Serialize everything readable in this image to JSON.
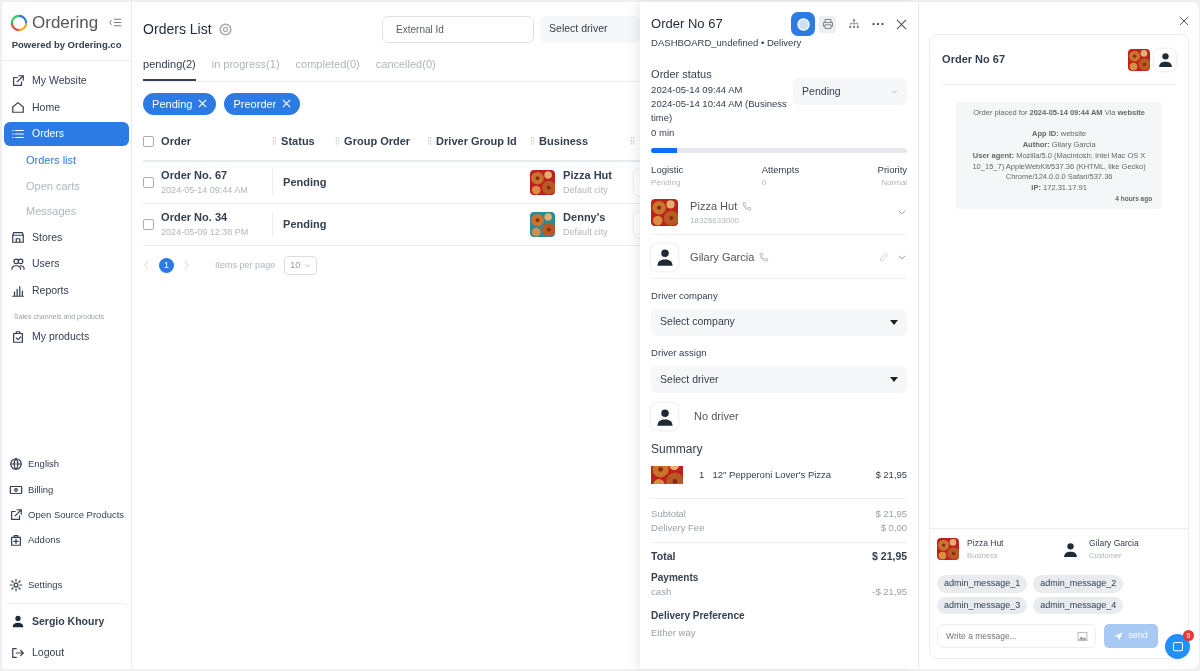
{
  "sidebar": {
    "logo": "Ordering",
    "powered_by": "Powered by Ordering.co",
    "items": [
      {
        "kind": "item",
        "label": "My Website",
        "selected": false
      },
      {
        "kind": "item",
        "label": "Home",
        "selected": false
      },
      {
        "kind": "item",
        "label": "Orders",
        "selected": true
      },
      {
        "kind": "sub",
        "label": "Orders list",
        "selected": true
      },
      {
        "kind": "sub",
        "label": "Open carts",
        "selected": false
      },
      {
        "kind": "sub",
        "label": "Messages",
        "selected": false
      },
      {
        "kind": "item",
        "label": "Stores",
        "selected": false
      },
      {
        "kind": "item",
        "label": "Users",
        "selected": false
      },
      {
        "kind": "item",
        "label": "Reports",
        "selected": false
      },
      {
        "kind": "section",
        "label": "Sales channels and products"
      },
      {
        "kind": "item",
        "label": "My products",
        "selected": false
      }
    ],
    "bottom_items": [
      {
        "label": "English"
      },
      {
        "label": "Billing"
      },
      {
        "label": "Open Source Products"
      },
      {
        "label": "Addons"
      },
      {
        "label": "Settings"
      }
    ],
    "user": "Sergio Khoury",
    "logout": "Logout"
  },
  "orders": {
    "title": "Orders List",
    "external_id": {
      "placeholder": "External Id"
    },
    "driver_select": "Select driver",
    "tabs": [
      {
        "label": "pending(2)",
        "selected": true
      },
      {
        "label": "in progress(1)",
        "selected": false
      },
      {
        "label": "completed(0)",
        "selected": false
      },
      {
        "label": "cancelled(0)",
        "selected": false
      }
    ],
    "filters": [
      "Pending",
      "Preorder"
    ],
    "select_all": {
      "checked": false
    },
    "columns": [
      "Order",
      "Status",
      "Group Order",
      "Driver Group Id",
      "Business"
    ],
    "rows": [
      {
        "checked": false,
        "order": "Order No. 67",
        "date": "2024-05-14 09:44 AM",
        "status": "Pending",
        "business": "Pizza Hut",
        "city": "Default city"
      },
      {
        "checked": false,
        "order": "Order No. 34",
        "date": "2024-05-09 12:38 PM",
        "status": "Pending",
        "business": "Denny's",
        "city": "Default city"
      }
    ],
    "pagination": {
      "page": "1",
      "items_per_page_label": "Items per page",
      "items_per_page": "10"
    }
  },
  "order_panel": {
    "title": "Order No 67",
    "subtitle": "DASHBOARD_undefined • Delivery",
    "status_label": "Order status",
    "status_lines": [
      "2024-05-14 09:44 AM",
      "2024-05-14 10:44 AM (Business time)",
      "0 min"
    ],
    "status_select": "Pending",
    "progress": {
      "level": 0.1
    },
    "info": [
      {
        "label": "Logistic",
        "value": "Pending"
      },
      {
        "label": "Attempts",
        "value": "0"
      },
      {
        "label": "Priority",
        "value": "Normal"
      }
    ],
    "business": {
      "name": "Pizza Hut",
      "phone": "18326633000"
    },
    "customer": {
      "name": "Gilary Garcia"
    },
    "driver_company_label": "Driver company",
    "driver_company_select": "Select company",
    "driver_assign_label": "Driver assign",
    "driver_select": "Select driver",
    "no_driver": "No driver",
    "summary_title": "Summary",
    "products": [
      {
        "qty": "1",
        "name": "12\" Pepperoni Lover's Pizza",
        "price": "$ 21,95"
      }
    ],
    "totals": [
      {
        "label": "Subtotal",
        "value": "$ 21,95"
      },
      {
        "label": "Delivery Fee",
        "value": "$ 0,00"
      }
    ],
    "total": {
      "label": "Total",
      "value": "$ 21,95"
    },
    "payments_title": "Payments",
    "payments": [
      {
        "method": "cash",
        "amount": "-$ 21,95"
      }
    ],
    "delivery_pref_title": "Delivery Preference",
    "delivery_pref": "Either way"
  },
  "chat": {
    "title": "Order No 67",
    "message": {
      "header": "Order placed for **2024-05-14 09:44 AM** Via **website**",
      "lines": [
        "**App ID:** website",
        "**Author:** Gilary Garcia",
        "**User agent:** Mozilla/5.0 (Macintosh; Intel Mac OS X 10_15_7) AppleWebKit/537.36 (KHTML, like Gecko) Chrome/124.0.0.0 Safari/537.36",
        "**IP:** 172.31.17.91"
      ],
      "time": "4 hours ago"
    },
    "participants": [
      {
        "kind": "business",
        "name": "Pizza Hut",
        "role": "Business"
      },
      {
        "kind": "customer",
        "name": "Gilary Garcia",
        "role": "Customer"
      }
    ],
    "quick_messages": [
      "admin_message_1",
      "admin_message_2",
      "admin_message_3",
      "admin_message_4"
    ],
    "input": {
      "placeholder": "Write a message..."
    },
    "send": "send",
    "unread_badge": "6"
  }
}
